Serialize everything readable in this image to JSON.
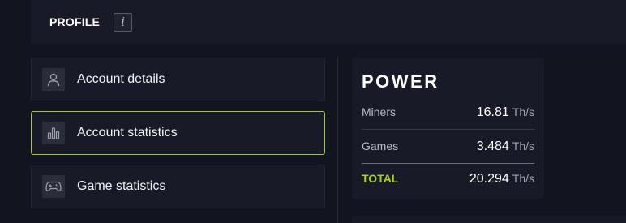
{
  "header": {
    "title": "PROFILE",
    "info_icon": "info-icon"
  },
  "menu": {
    "items": [
      {
        "label": "Account details",
        "icon": "user-icon",
        "active": false
      },
      {
        "label": "Account statistics",
        "icon": "bar-chart-icon",
        "active": true
      },
      {
        "label": "Game statistics",
        "icon": "gamepad-icon",
        "active": false
      }
    ]
  },
  "power": {
    "title": "POWER",
    "rows": [
      {
        "label": "Miners",
        "value": "16.81",
        "unit": "Th/s"
      },
      {
        "label": "Games",
        "value": "3.484",
        "unit": "Th/s"
      },
      {
        "label": "TOTAL",
        "value": "20.294",
        "unit": "Th/s"
      }
    ]
  },
  "colors": {
    "accent": "#9ccc2c",
    "background": "#121520",
    "card": "#181b27"
  }
}
